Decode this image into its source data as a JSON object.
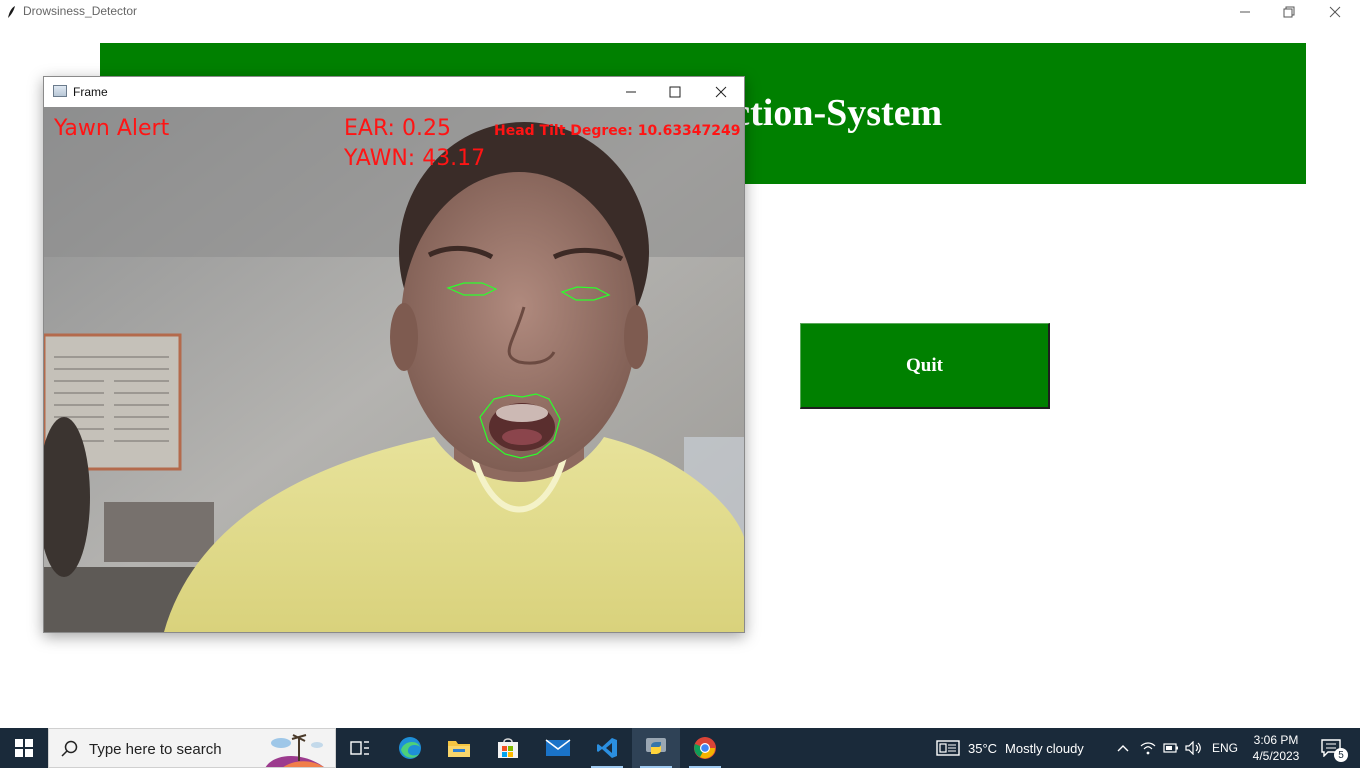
{
  "main_window": {
    "title": "Drowsiness_Detector",
    "icons": {
      "app": "feather-icon",
      "minimize": "minimize-icon",
      "restore": "restore-icon",
      "close": "close-icon"
    }
  },
  "app": {
    "header_title": "Drowsiness-Detection-System",
    "quit_label": "Quit",
    "accent_color": "#008000"
  },
  "frame_window": {
    "title": "Frame",
    "overlay": {
      "alert": "Yawn Alert",
      "ear": "EAR: 0.25",
      "yawn": "YAWN: 43.17",
      "head_tilt": "Head Tilt Degree: 10.63347249"
    },
    "overlay_color": "#ff1414",
    "landmark_color": "#2cff2c"
  },
  "taskbar": {
    "search_placeholder": "Type here to search",
    "weather_temp": "35°C",
    "weather_desc": "Mostly cloudy",
    "language": "ENG",
    "time": "3:06 PM",
    "date": "4/5/2023",
    "notification_count": "5"
  }
}
